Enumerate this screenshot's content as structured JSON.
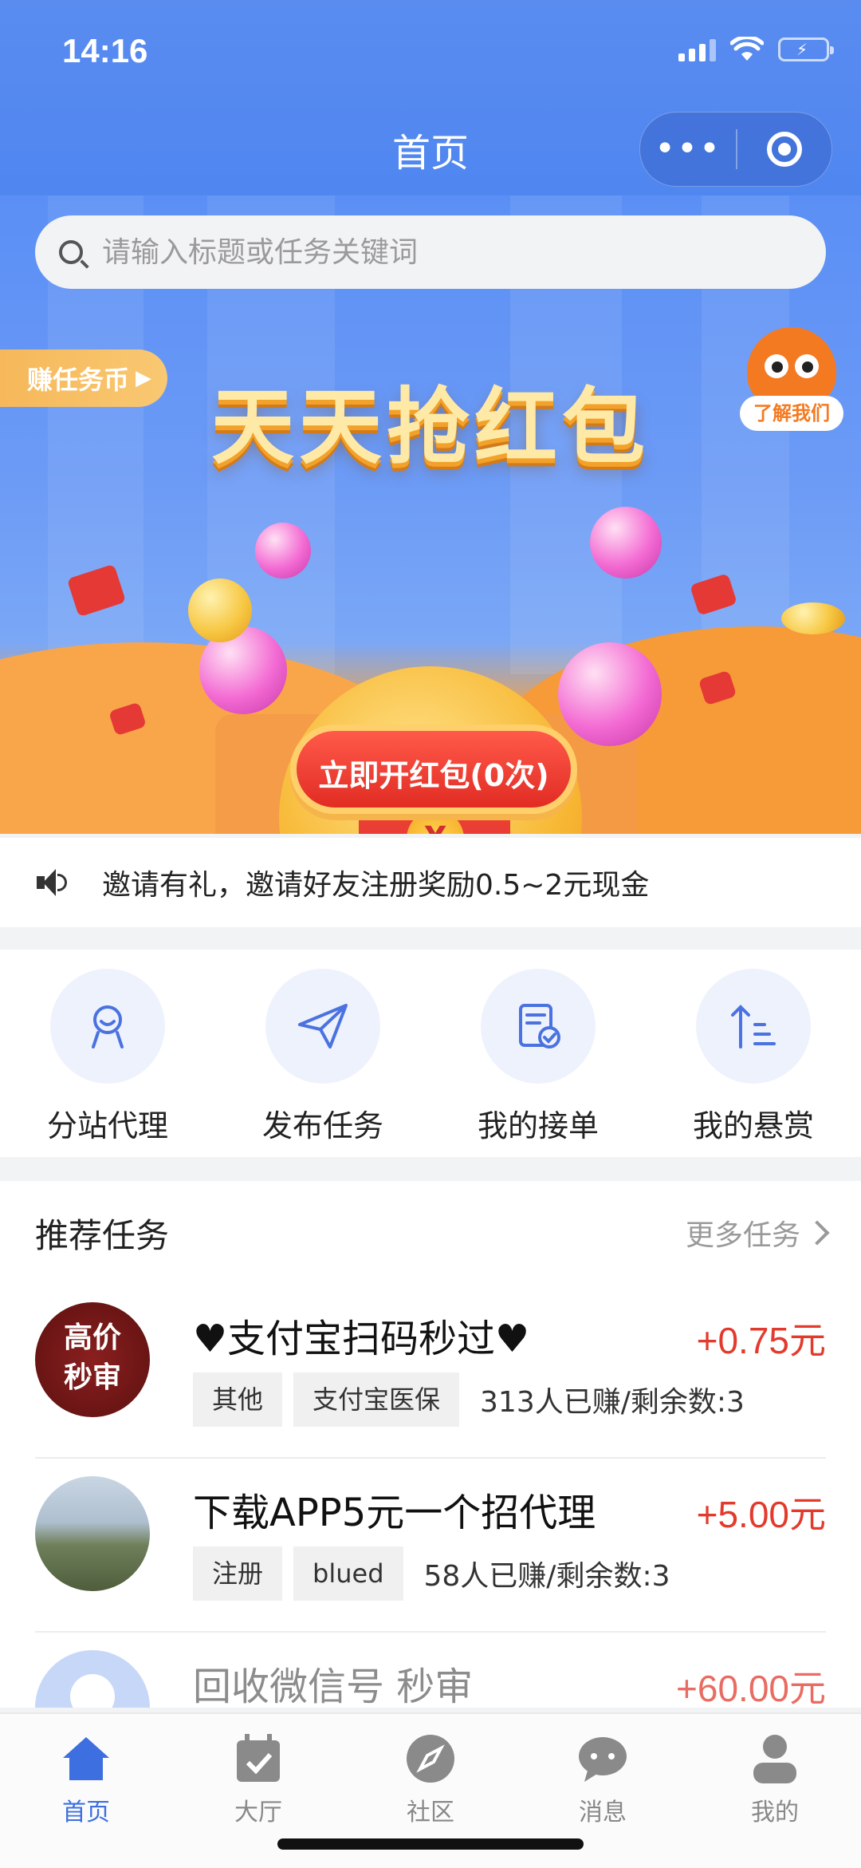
{
  "status_bar": {
    "time": "14:16"
  },
  "nav": {
    "title": "首页"
  },
  "search": {
    "placeholder": "请输入标题或任务关键词"
  },
  "banner": {
    "earn_tag": "赚任务币",
    "about_label": "了解我们",
    "headline": "天天抢红包",
    "coin_symbol": "¥",
    "open_button": "立即开红包(0次)"
  },
  "notice": {
    "text": "邀请有礼，邀请好友注册奖励0.5~2元现金"
  },
  "quick_entries": [
    {
      "label": "分站代理",
      "icon": "agent-person-icon"
    },
    {
      "label": "发布任务",
      "icon": "paper-plane-icon"
    },
    {
      "label": "我的接单",
      "icon": "order-check-icon"
    },
    {
      "label": "我的悬赏",
      "icon": "sort-ascending-icon"
    }
  ],
  "recommended": {
    "title": "推荐任务",
    "more_label": "更多任务",
    "tasks": [
      {
        "avatar_text_1": "高价",
        "avatar_text_2": "秒审",
        "title": "♥支付宝扫码秒过♥",
        "price": "+0.75元",
        "tags": [
          "其他",
          "支付宝医保"
        ],
        "stat": "313人已赚/剩余数:3"
      },
      {
        "title": "下载APP5元一个招代理",
        "price": "+5.00元",
        "tags": [
          "注册",
          "blued"
        ],
        "stat": "58人已赚/剩余数:3"
      },
      {
        "title": "回收微信号 秒审",
        "price": "+60.00元",
        "tags": [
          "",
          ""
        ],
        "stat": ""
      }
    ]
  },
  "tabbar": [
    {
      "label": "首页",
      "icon": "home-icon",
      "active": true
    },
    {
      "label": "大厅",
      "icon": "calendar-check-icon",
      "active": false
    },
    {
      "label": "社区",
      "icon": "compass-icon",
      "active": false
    },
    {
      "label": "消息",
      "icon": "chat-bubble-icon",
      "active": false
    },
    {
      "label": "我的",
      "icon": "user-icon",
      "active": false
    }
  ],
  "colors": {
    "primary": "#4f86f0",
    "accent_red": "#e23b2e",
    "tab_active": "#3d6fe0"
  }
}
